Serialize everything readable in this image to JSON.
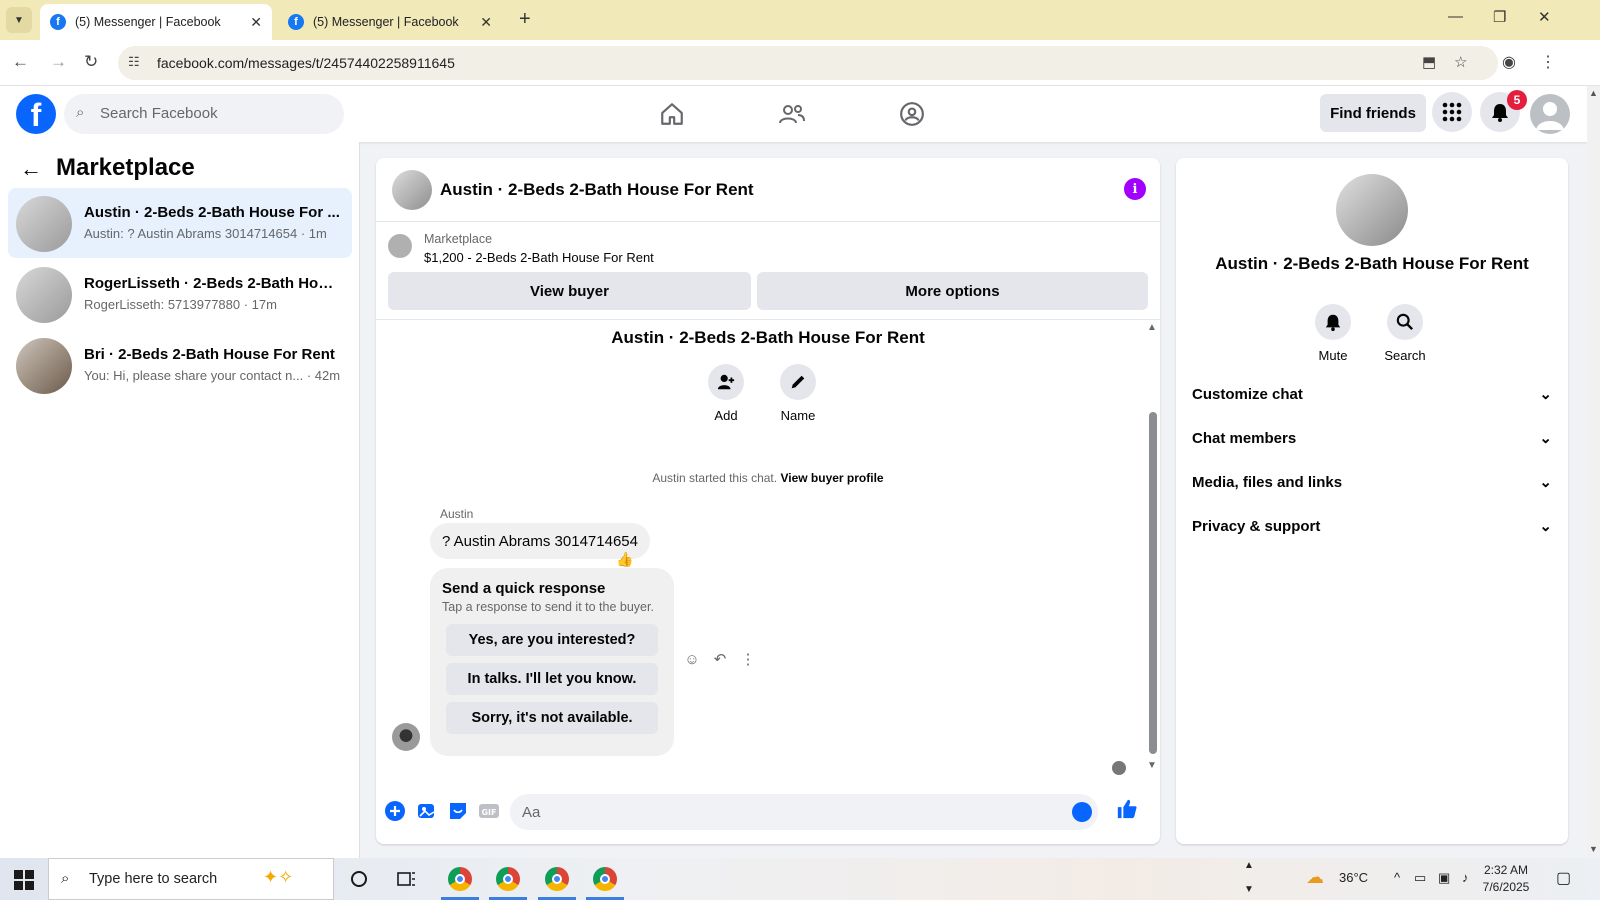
{
  "browser": {
    "tabs": [
      {
        "title": "(5) Messenger | Facebook",
        "active": true
      },
      {
        "title": "(5) Messenger | Facebook",
        "active": false
      }
    ],
    "url": "facebook.com/messages/t/24574402258911645"
  },
  "fb_header": {
    "search_placeholder": "Search Facebook",
    "find_friends_label": "Find friends",
    "notification_count": "5",
    "logo_letter": "f"
  },
  "sidebar": {
    "title": "Marketplace",
    "conversations": [
      {
        "name": "Austin · 2-Beds 2-Bath House For ...",
        "preview": "Austin: ? Austin Abrams 3014714654 · 1m",
        "active": true
      },
      {
        "name": "RogerLisseth · 2-Beds 2-Bath Hous...",
        "preview": "RogerLisseth: 5713977880 · 17m",
        "active": false
      },
      {
        "name": "Bri · 2-Beds 2-Bath House For Rent",
        "preview": "You: Hi, please share your contact n... · 42m",
        "active": false
      }
    ]
  },
  "chat": {
    "header_title": "Austin · 2-Beds 2-Bath House For Rent",
    "listing_label": "Marketplace",
    "listing_price": "$1,200 - 2-Beds 2-Bath House For Rent",
    "view_buyer_label": "View buyer",
    "more_options_label": "More options",
    "thread_title": "Austin · 2-Beds 2-Bath House For Rent",
    "add_label": "Add",
    "name_label": "Name",
    "started_text": "Austin started this chat.",
    "view_buyer_profile": "View buyer profile",
    "sender_name": "Austin",
    "message_text": "? Austin Abrams 3014714654",
    "quick_title": "Send a quick response",
    "quick_subtitle": "Tap a response to send it to the buyer.",
    "quick_responses": [
      "Yes, are you interested?",
      "In talks. I'll let you know.",
      "Sorry, it's not available."
    ],
    "composer_placeholder": "Aa"
  },
  "info_panel": {
    "name": "Austin · 2-Beds 2-Bath House For Rent",
    "mute_label": "Mute",
    "search_label": "Search",
    "sections": [
      "Customize chat",
      "Chat members",
      "Media, files and links",
      "Privacy & support"
    ]
  },
  "taskbar": {
    "search_placeholder": "Type here to search",
    "temperature": "36°C",
    "time": "2:32 AM",
    "date": "7/6/2025"
  },
  "colors": {
    "fb_blue": "#0866ff",
    "active_row": "#e7f0fd",
    "info_purple": "#a100ff",
    "badge_red": "#e41e3f",
    "tabstrip": "#f1e9b8"
  }
}
